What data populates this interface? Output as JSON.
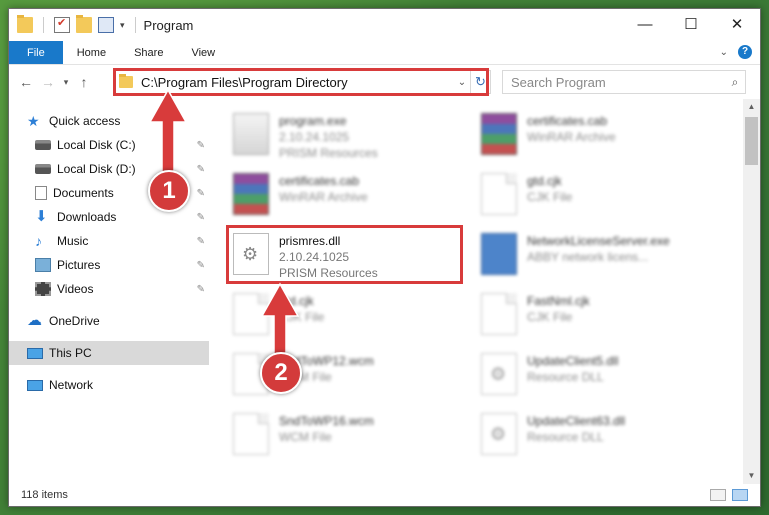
{
  "window": {
    "title": "Program",
    "controls": {
      "minimize": "—",
      "maximize": "☐",
      "close": "✕"
    }
  },
  "ribbon": {
    "tabs": [
      "File",
      "Home",
      "Share",
      "View"
    ],
    "help": "?"
  },
  "navigation": {
    "address": "C:\\Program Files\\Program Directory",
    "search_placeholder": "Search Program"
  },
  "sidebar": {
    "quick_access": "Quick access",
    "items": [
      {
        "label": "Local Disk (C:)",
        "icon": "disk-icon",
        "pinned": true
      },
      {
        "label": "Local Disk (D:)",
        "icon": "disk-icon",
        "pinned": true
      },
      {
        "label": "Documents",
        "icon": "documents-icon",
        "pinned": true
      },
      {
        "label": "Downloads",
        "icon": "downloads-icon",
        "pinned": true
      },
      {
        "label": "Music",
        "icon": "music-icon",
        "pinned": true
      },
      {
        "label": "Pictures",
        "icon": "pictures-icon",
        "pinned": true
      },
      {
        "label": "Videos",
        "icon": "videos-icon",
        "pinned": true
      }
    ],
    "onedrive": "OneDrive",
    "this_pc": "This PC",
    "network": "Network"
  },
  "files": [
    {
      "name": "program.exe",
      "line1": "2.10.24.1025",
      "line2": "PRISM Resources",
      "type": "exe"
    },
    {
      "name": "certificates.cab",
      "line1": "WinRAR Archive",
      "line2": "",
      "type": "rar"
    },
    {
      "name": "certificates.cab",
      "line1": "WinRAR Archive",
      "line2": "",
      "type": "rar"
    },
    {
      "name": "gtd.cjk",
      "line1": "CJK File",
      "line2": "",
      "type": "generic"
    },
    {
      "name": "prismres.dll",
      "line1": "2.10.24.1025",
      "line2": "PRISM Resources",
      "type": "dll"
    },
    {
      "name": "NetworkLicenseServer.exe",
      "line1": "ABBY network licens...",
      "line2": "",
      "type": "app"
    },
    {
      "name": "gtd.cjk",
      "line1": "CJK File",
      "line2": "",
      "type": "generic"
    },
    {
      "name": "FastNml.cjk",
      "line1": "CJK File",
      "line2": "",
      "type": "generic"
    },
    {
      "name": "SndToWP12.wcm",
      "line1": "WCM File",
      "line2": "",
      "type": "generic"
    },
    {
      "name": "UpdateClient5.dll",
      "line1": "Resource DLL",
      "line2": "",
      "type": "dll"
    },
    {
      "name": "SndToWP16.wcm",
      "line1": "WCM File",
      "line2": "",
      "type": "generic"
    },
    {
      "name": "UpdateClient63.dll",
      "line1": "Resource DLL",
      "line2": "",
      "type": "dll"
    }
  ],
  "status": {
    "count": "118 items"
  },
  "callouts": [
    "1",
    "2"
  ],
  "colors": {
    "accent": "#1979ca",
    "highlight": "#d83b3b"
  }
}
